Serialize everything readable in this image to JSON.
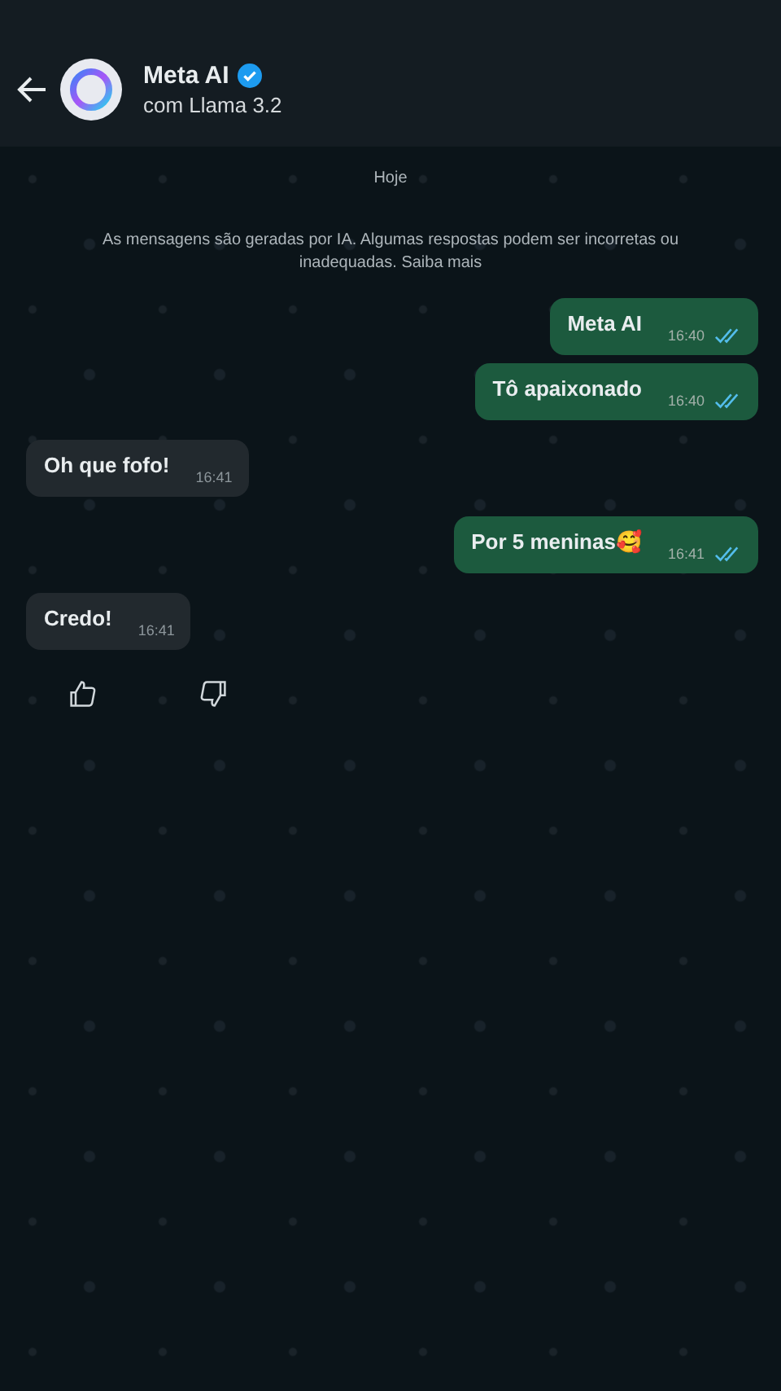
{
  "header": {
    "title": "Meta AI",
    "verified": true,
    "subtitle": "com Llama 3.2"
  },
  "date_label": "Hoje",
  "notice": {
    "text": "As mensagens são geradas por IA. Algumas respostas podem ser incorretas ou inadequadas.",
    "link": "Saiba mais"
  },
  "messages": [
    {
      "kind": "outgoing",
      "text": "Meta AI",
      "time": "16:40",
      "read": true
    },
    {
      "kind": "outgoing",
      "text": "Tô apaixonado",
      "time": "16:40",
      "read": true
    },
    {
      "kind": "incoming",
      "text": "Oh que fofo!",
      "time": "16:41"
    },
    {
      "kind": "outgoing",
      "text": "Por 5 meninas🥰",
      "time": "16:41",
      "read": true
    },
    {
      "kind": "incoming",
      "text": "Credo!",
      "time": "16:41"
    }
  ],
  "feedback": {
    "thumbs_up": true,
    "thumbs_down": true
  }
}
